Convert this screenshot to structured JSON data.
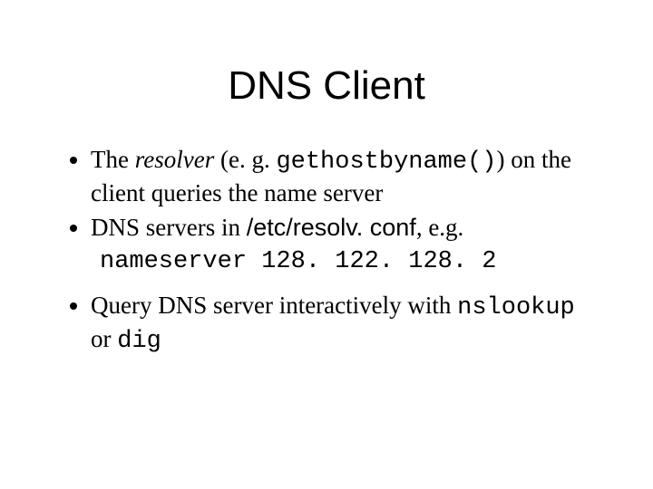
{
  "title": "DNS Client",
  "b1_pre": "The ",
  "b1_resolver": "resolver",
  "b1_mid": " (e. g. ",
  "b1_code": "gethostbyname()",
  "b1_post": ") on the client queries the name server",
  "b2_pre": "DNS servers in ",
  "b2_file": "/etc/resolv. conf",
  "b2_post": ", e.g.",
  "b2_example": "nameserver 128. 122. 128. 2",
  "b3_pre": "Query DNS server interactively with ",
  "b3_cmd1": "nslookup",
  "b3_or": " or ",
  "b3_cmd2": "dig"
}
